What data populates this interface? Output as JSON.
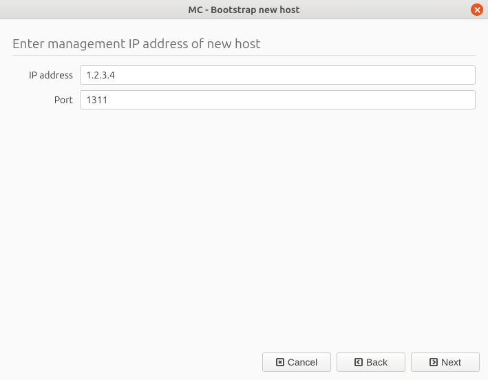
{
  "window": {
    "title": "MC - Bootstrap new host"
  },
  "header": {
    "text": "Enter management IP address of new host"
  },
  "form": {
    "ip": {
      "label": "IP address",
      "value": "1.2.3.4"
    },
    "port": {
      "label": "Port",
      "value": "1311"
    }
  },
  "buttons": {
    "cancel": "Cancel",
    "back": "Back",
    "next": "Next"
  }
}
